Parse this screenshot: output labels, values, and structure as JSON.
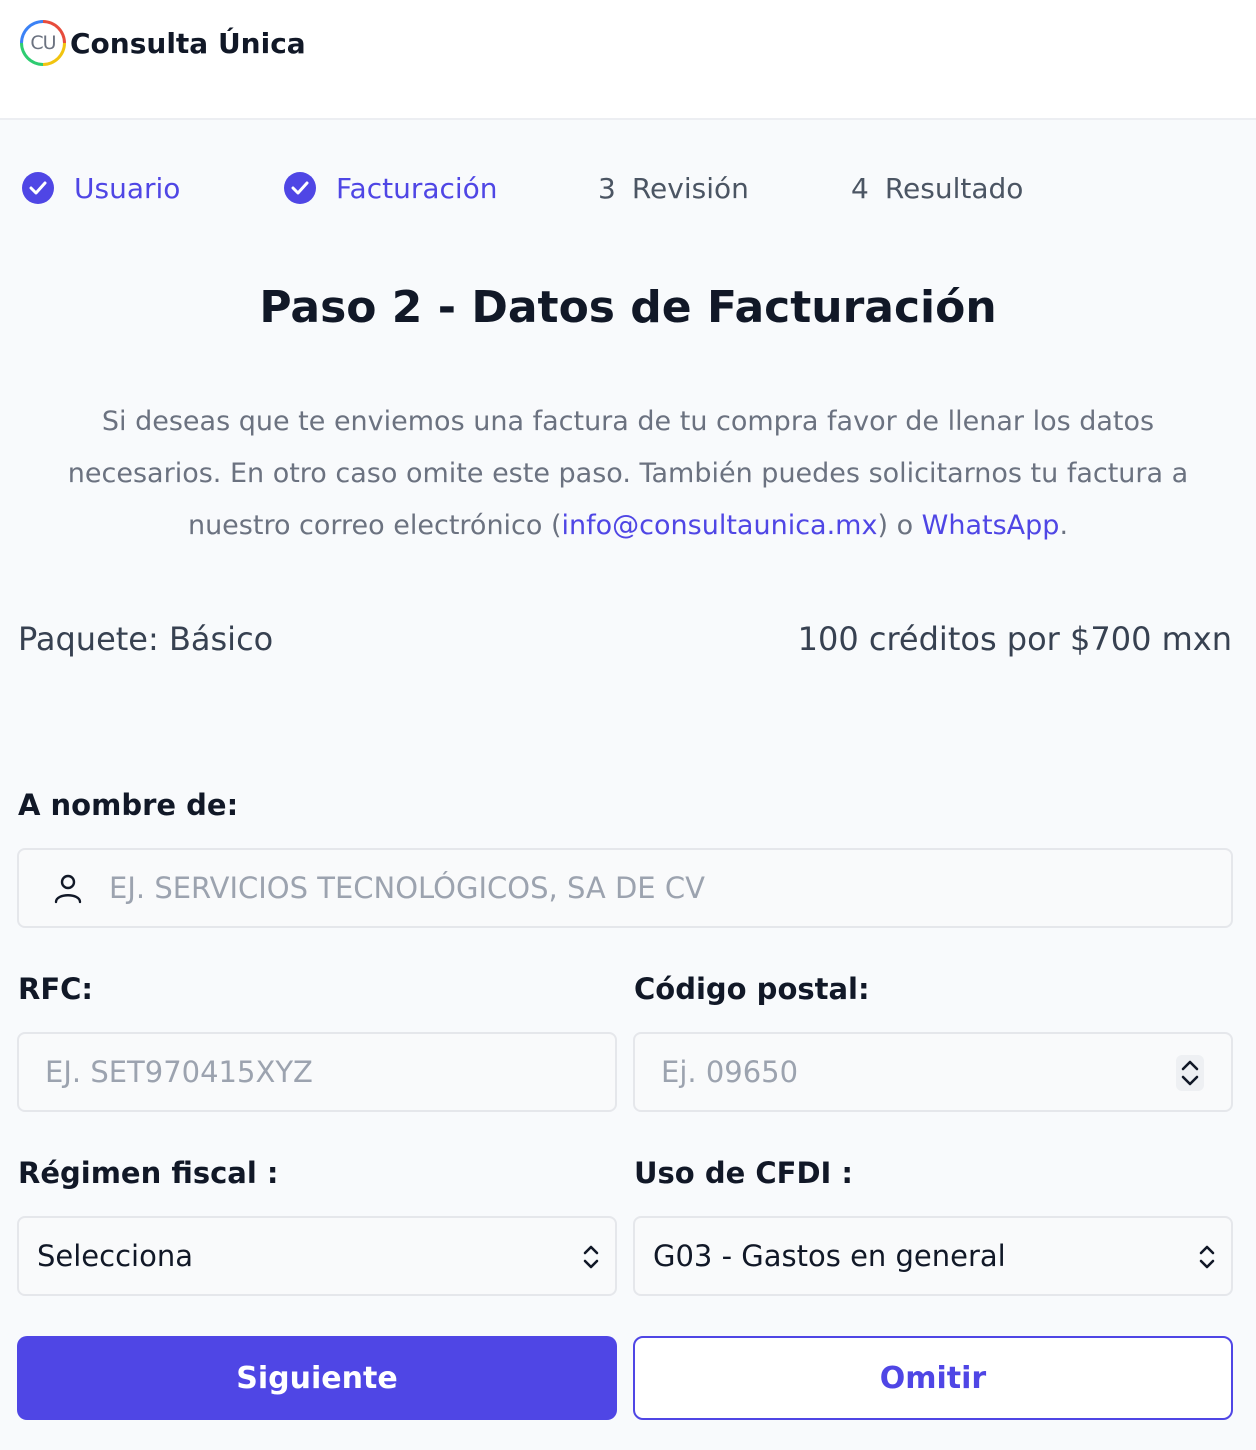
{
  "header": {
    "logo_initials": "CU",
    "brand": "Consulta Única"
  },
  "steps": [
    {
      "number": "1",
      "label": "Usuario",
      "status": "complete"
    },
    {
      "number": "2",
      "label": "Facturación",
      "status": "complete"
    },
    {
      "number": "3",
      "label": "Revisión",
      "status": "pending"
    },
    {
      "number": "4",
      "label": "Resultado",
      "status": "pending"
    }
  ],
  "page": {
    "title": "Paso 2 - Datos de Facturación",
    "description_part1": "Si deseas que te enviemos una factura de tu compra favor de llenar los datos necesarios. En otro caso omite este paso. También puedes solicitarnos tu factura a nuestro correo electrónico (",
    "email_link": "info@consultaunica.mx",
    "description_part2": ") o ",
    "whatsapp_link": "WhatsApp",
    "description_part3": "."
  },
  "package": {
    "name": "Paquete: Básico",
    "price": "100 créditos por $700 mxn"
  },
  "form": {
    "name_label": "A nombre de:",
    "name_placeholder": "EJ. SERVICIOS TECNOLÓGICOS, SA DE CV",
    "rfc_label": "RFC:",
    "rfc_placeholder": "EJ. SET970415XYZ",
    "zip_label": "Código postal:",
    "zip_placeholder": "Ej. 09650",
    "regimen_label": "Régimen fiscal :",
    "regimen_value": "Selecciona",
    "cfdi_label": "Uso de CFDI :",
    "cfdi_value": "G03 - Gastos en general"
  },
  "buttons": {
    "next": "Siguiente",
    "skip": "Omitir"
  },
  "colors": {
    "accent": "#4f46e5",
    "muted_text": "#6b7280",
    "border": "#e5e7eb"
  }
}
